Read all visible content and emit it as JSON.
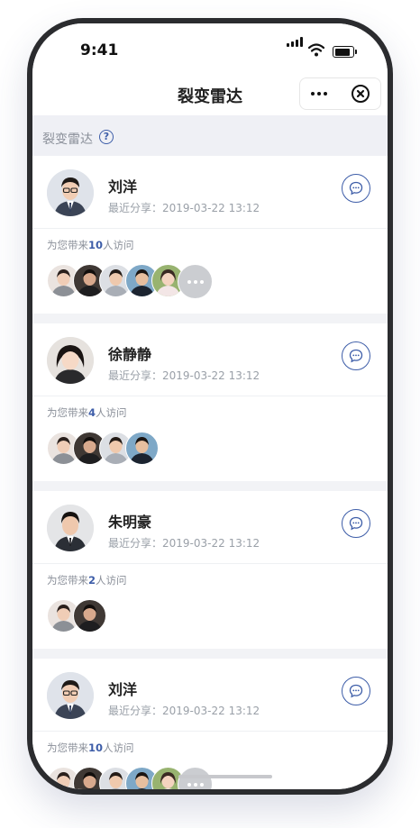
{
  "status_bar": {
    "time": "9:41"
  },
  "navbar": {
    "title": "裂变雷达"
  },
  "section": {
    "title": "裂变雷达",
    "help_icon": "question-circle-icon"
  },
  "colors": {
    "accent": "#3d5da8",
    "muted_text": "#9aa0a8",
    "background": "#f2f3f6"
  },
  "cards": [
    {
      "name": "刘洋",
      "share_label": "最近分享：",
      "share_time": "2019-03-22 13:12",
      "visit_prefix": "为您带来",
      "visit_count": "10",
      "visit_suffix": "人访问",
      "visitor_avatars": 5,
      "has_more": true
    },
    {
      "name": "徐静静",
      "share_label": "最近分享：",
      "share_time": "2019-03-22 13:12",
      "visit_prefix": "为您带来",
      "visit_count": "4",
      "visit_suffix": "人访问",
      "visitor_avatars": 4,
      "has_more": false
    },
    {
      "name": "朱明豪",
      "share_label": "最近分享：",
      "share_time": "2019-03-22 13:12",
      "visit_prefix": "为您带来",
      "visit_count": "2",
      "visit_suffix": "人访问",
      "visitor_avatars": 2,
      "has_more": false
    },
    {
      "name": "刘洋",
      "share_label": "最近分享：",
      "share_time": "2019-03-22 13:12",
      "visit_prefix": "为您带来",
      "visit_count": "10",
      "visit_suffix": "人访问",
      "visitor_avatars": 5,
      "has_more": true
    }
  ]
}
